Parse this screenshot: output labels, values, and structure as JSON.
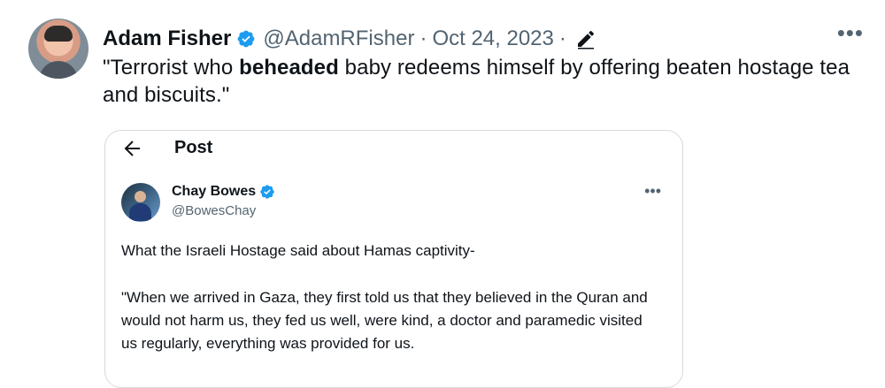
{
  "tweet": {
    "author_name": "Adam Fisher",
    "author_handle": "@AdamRFisher",
    "date": "Oct 24, 2023",
    "text_before": "\"Terrorist who ",
    "text_bold": "beheaded",
    "text_after": " baby redeems himself by offering beaten hostage tea and biscuits.\"",
    "more_label": "•••",
    "icons": {
      "verified": "verified-icon",
      "edit": "pencil-icon",
      "more": "more-icon"
    }
  },
  "quote": {
    "title": "Post",
    "author_name": "Chay Bowes",
    "author_handle": "@BowesChay",
    "line1": "What the Israeli Hostage said about Hamas captivity-",
    "body": "\"When we arrived in Gaza, they first told us that they believed in the Quran and would not harm us, they fed us well, were kind,  a doctor and paramedic visited us regularly, everything was provided for us.",
    "more_label": "•••"
  },
  "colors": {
    "accent": "#1d9bf0",
    "secondary_text": "#536471",
    "border": "#d9d9d9"
  }
}
